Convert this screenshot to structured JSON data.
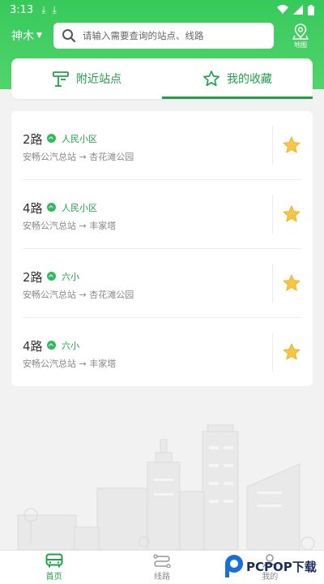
{
  "status": {
    "time": "3:13"
  },
  "header": {
    "city": "神木",
    "search_placeholder": "请输入需要查询的站点、线路",
    "map_label": "地图"
  },
  "tabs": [
    {
      "label": "附近站点",
      "active": false
    },
    {
      "label": "我的收藏",
      "active": true
    }
  ],
  "favorites": [
    {
      "route": "2路",
      "station": "人民小区",
      "from": "安畅公汽总站",
      "to": "杏花滩公园",
      "favorited": true
    },
    {
      "route": "4路",
      "station": "人民小区",
      "from": "安畅公汽总站",
      "to": "丰家塔",
      "favorited": true
    },
    {
      "route": "2路",
      "station": "六小",
      "from": "安畅公汽总站",
      "to": "杏花滩公园",
      "favorited": true
    },
    {
      "route": "4路",
      "station": "六小",
      "from": "安畅公汽总站",
      "to": "丰家塔",
      "favorited": true
    }
  ],
  "nav": [
    {
      "label": "首页",
      "icon": "bus-icon",
      "active": true
    },
    {
      "label": "线路",
      "icon": "route-icon",
      "active": false
    },
    {
      "label": "我的",
      "icon": "user-icon",
      "active": false
    }
  ],
  "watermark": {
    "text": "PCPOP下载"
  },
  "colors": {
    "primary": "#21a04a",
    "header_green": "#3ccb5f",
    "star": "#f6c644"
  }
}
